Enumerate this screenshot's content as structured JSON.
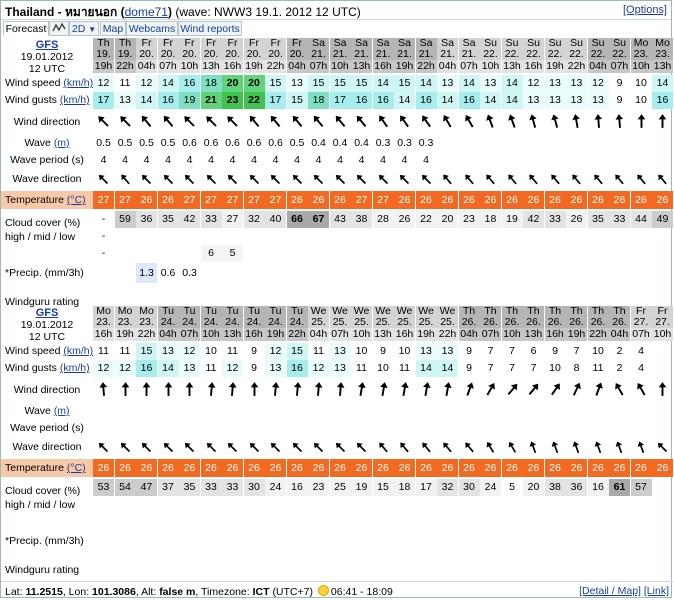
{
  "header": {
    "title_prefix": "Thailand - หมายนอก",
    "spot_link": "dome71",
    "wave_info": "(wave: NWW3 19.1. 2012 12 UTC)",
    "options_link": "[Options]"
  },
  "tabs": {
    "forecast": "Forecast",
    "graph_icon": "graph-icon",
    "twod": "2D",
    "map": "Map",
    "webcams": "Webcams",
    "wind_reports": "Wind reports"
  },
  "labels": {
    "wind_speed": "Wind speed",
    "wind_gusts": "Wind gusts",
    "kmh": "(km/h)",
    "wind_direction": "Wind direction",
    "wave": "Wave",
    "wave_unit": "(m)",
    "wave_period": "Wave period (s)",
    "wave_direction": "Wave direction",
    "temperature": "Temperature",
    "temp_unit": "(°C)",
    "cloud_cover": "Cloud cover (%)",
    "cloud_levels": "high / mid / low",
    "precip": "*Precip. (mm/3h)",
    "rating": "Windguru rating"
  },
  "colors": {
    "header_light": "#d3d3d3",
    "header_dark": "#b5b5b5",
    "temp_bg": "#f26a21",
    "link": "#1a3d9a",
    "cloud_light": "#f2f2f2",
    "cloud_mid": "#cccccc",
    "cloud_dark": "#a9a9a9",
    "precip_bg": "#dfe8fa"
  },
  "blocks": [
    {
      "model": "GFS",
      "date": "19.01.2012",
      "utc": "12 UTC",
      "days": [
        "Th",
        "Th",
        "Fr",
        "Fr",
        "Fr",
        "Fr",
        "Fr",
        "Fr",
        "Fr",
        "Fr",
        "Sa",
        "Sa",
        "Sa",
        "Sa",
        "Sa",
        "Sa",
        "Sa",
        "Sa",
        "Su",
        "Su",
        "Su",
        "Su",
        "Su",
        "Su",
        "Su",
        "Mo",
        "Mo",
        "Mo"
      ],
      "dates": [
        "19.",
        "19.",
        "20.",
        "20.",
        "20.",
        "20.",
        "20.",
        "20.",
        "20.",
        "20.",
        "21.",
        "21.",
        "21.",
        "21.",
        "21.",
        "21.",
        "21.",
        "21.",
        "22.",
        "22.",
        "22.",
        "22.",
        "22.",
        "22.",
        "22.",
        "23.",
        "23.",
        "23."
      ],
      "hours": [
        "19h",
        "22h",
        "04h",
        "07h",
        "10h",
        "13h",
        "16h",
        "19h",
        "22h",
        "04h",
        "07h",
        "10h",
        "13h",
        "16h",
        "19h",
        "22h",
        "04h",
        "07h",
        "10h",
        "13h",
        "16h",
        "19h",
        "22h",
        "04h",
        "07h",
        "10h",
        "13h",
        "13h"
      ],
      "shaded": [
        1,
        1,
        0,
        0,
        0,
        0,
        0,
        0,
        0,
        1,
        1,
        1,
        1,
        1,
        1,
        1,
        0,
        0,
        0,
        0,
        0,
        0,
        0,
        1,
        1,
        1,
        1,
        1
      ],
      "wind_speed": [
        "12",
        "11",
        "12",
        "14",
        "16",
        "18",
        "20",
        "20",
        "15",
        "13",
        "15",
        "15",
        "15",
        "14",
        "15",
        "14",
        "13",
        "14",
        "13",
        "14",
        "12",
        "13",
        "13",
        "12",
        "9",
        "10",
        "14",
        "12"
      ],
      "wind_gusts": [
        "17",
        "13",
        "14",
        "16",
        "19",
        "21",
        "23",
        "22",
        "17",
        "15",
        "18",
        "17",
        "16",
        "16",
        "14",
        "16",
        "14",
        "16",
        "14",
        "14",
        "13",
        "13",
        "13",
        "13",
        "9",
        "10",
        "16",
        "13"
      ],
      "wind_dir": [
        315,
        315,
        320,
        320,
        315,
        315,
        315,
        320,
        320,
        320,
        320,
        320,
        320,
        325,
        325,
        325,
        330,
        330,
        340,
        340,
        345,
        345,
        350,
        355,
        355,
        0,
        0,
        350
      ],
      "wave": [
        "0.5",
        "0.5",
        "0.5",
        "0.5",
        "0.6",
        "0.6",
        "0.6",
        "0.6",
        "0.6",
        "0.5",
        "0.4",
        "0.4",
        "0.4",
        "0.3",
        "0.3",
        "0.3",
        "",
        "",
        "",
        "",
        "",
        "",
        "",
        "",
        "",
        "",
        "",
        ""
      ],
      "wave_period": [
        "4",
        "4",
        "4",
        "4",
        "4",
        "4",
        "4",
        "4",
        "4",
        "4",
        "4",
        "4",
        "4",
        "4",
        "4",
        "4",
        "",
        "",
        "",
        "",
        "",
        "",
        "",
        "",
        "",
        "",
        "",
        ""
      ],
      "wave_dir": [
        315,
        320,
        315,
        315,
        315,
        315,
        315,
        315,
        315,
        315,
        315,
        315,
        315,
        315,
        315,
        315,
        320,
        320,
        320,
        320,
        320,
        320,
        320,
        320,
        320,
        320,
        320,
        315
      ],
      "temperature": [
        "27",
        "27",
        "26",
        "26",
        "27",
        "27",
        "27",
        "27",
        "27",
        "26",
        "26",
        "26",
        "27",
        "27",
        "26",
        "26",
        "26",
        "26",
        "26",
        "26",
        "26",
        "26",
        "26",
        "26",
        "26",
        "26",
        "26",
        "26"
      ],
      "cloud": [
        "-",
        "59",
        "36",
        "35",
        "42",
        "33",
        "27",
        "32",
        "40",
        "66",
        "67",
        "43",
        "38",
        "28",
        "26",
        "22",
        "20",
        "23",
        "18",
        "19",
        "42",
        "33",
        "26",
        "35",
        "33",
        "44",
        "49",
        ""
      ],
      "cloud_mid": [
        "-",
        "",
        "",
        "",
        "",
        "",
        "",
        "",
        "",
        "",
        "",
        "",
        "",
        "",
        "",
        "",
        "",
        "",
        "",
        "",
        "",
        "",
        "",
        "",
        "",
        "",
        "",
        ""
      ],
      "cloud_low": [
        "-",
        "",
        "",
        "",
        "",
        "6",
        "5",
        "",
        "",
        "",
        "",
        "",
        "",
        "",
        "",
        "",
        "",
        "",
        "",
        "",
        "",
        "",
        "",
        "",
        "",
        "",
        "",
        ""
      ],
      "precip": [
        "",
        "",
        "1.3",
        "0.6",
        "0.3",
        "",
        "",
        "",
        "",
        "",
        "",
        "",
        "",
        "",
        "",
        "",
        "",
        "",
        "",
        "",
        "",
        "",
        "",
        "",
        "",
        "",
        "",
        ""
      ]
    },
    {
      "model": "GFS",
      "date": "19.01.2012",
      "utc": "12 UTC",
      "days": [
        "Mo",
        "Mo",
        "Mo",
        "Tu",
        "Tu",
        "Tu",
        "Tu",
        "Tu",
        "Tu",
        "Tu",
        "We",
        "We",
        "We",
        "We",
        "We",
        "We",
        "We",
        "Th",
        "Th",
        "Th",
        "Th",
        "Th",
        "Th",
        "Th",
        "Th",
        "Fr",
        "Fr",
        "Fr"
      ],
      "dates": [
        "23.",
        "23.",
        "23.",
        "24.",
        "24.",
        "24.",
        "24.",
        "24.",
        "24.",
        "24.",
        "25.",
        "25.",
        "25.",
        "25.",
        "25.",
        "25.",
        "25.",
        "26.",
        "26.",
        "26.",
        "26.",
        "26.",
        "26.",
        "26.",
        "26.",
        "27.",
        "27.",
        "27."
      ],
      "hours": [
        "16h",
        "19h",
        "22h",
        "04h",
        "07h",
        "10h",
        "13h",
        "16h",
        "19h",
        "22h",
        "04h",
        "07h",
        "10h",
        "13h",
        "16h",
        "19h",
        "22h",
        "04h",
        "07h",
        "10h",
        "13h",
        "16h",
        "19h",
        "22h",
        "04h",
        "07h",
        "10h",
        "10h"
      ],
      "shaded": [
        0,
        0,
        0,
        1,
        1,
        1,
        1,
        1,
        1,
        1,
        0,
        0,
        0,
        0,
        0,
        0,
        0,
        1,
        1,
        1,
        1,
        1,
        1,
        1,
        1,
        0,
        0,
        0
      ],
      "wind_speed": [
        "11",
        "11",
        "15",
        "13",
        "12",
        "10",
        "11",
        "9",
        "12",
        "15",
        "11",
        "13",
        "10",
        "9",
        "10",
        "13",
        "13",
        "9",
        "7",
        "7",
        "6",
        "9",
        "7",
        "10",
        "2",
        "4",
        "",
        ""
      ],
      "wind_gusts": [
        "12",
        "12",
        "16",
        "14",
        "13",
        "11",
        "12",
        "9",
        "13",
        "16",
        "12",
        "13",
        "11",
        "10",
        "11",
        "14",
        "14",
        "9",
        "7",
        "7",
        "7",
        "10",
        "8",
        "11",
        "2",
        "4",
        "",
        ""
      ],
      "wind_dir": [
        355,
        0,
        0,
        0,
        0,
        5,
        5,
        0,
        5,
        5,
        5,
        5,
        10,
        10,
        10,
        10,
        10,
        20,
        30,
        40,
        40,
        35,
        25,
        20,
        330,
        330,
        0,
        0
      ],
      "wave": [
        "",
        "",
        "",
        "",
        "",
        "",
        "",
        "",
        "",
        "",
        "",
        "",
        "",
        "",
        "",
        "",
        "",
        "",
        "",
        "",
        "",
        "",
        "",
        "",
        "",
        "",
        "",
        ""
      ],
      "wave_period": [
        "",
        "",
        "",
        "",
        "",
        "",
        "",
        "",
        "",
        "",
        "",
        "",
        "",
        "",
        "",
        "",
        "",
        "",
        "",
        "",
        "",
        "",
        "",
        "",
        "",
        "",
        "",
        ""
      ],
      "wave_dir": [
        315,
        315,
        315,
        315,
        315,
        315,
        315,
        315,
        315,
        315,
        315,
        315,
        315,
        320,
        320,
        320,
        320,
        320,
        330,
        330,
        340,
        340,
        340,
        340,
        340,
        340,
        315,
        315
      ],
      "temperature": [
        "26",
        "26",
        "26",
        "26",
        "26",
        "26",
        "26",
        "26",
        "26",
        "26",
        "26",
        "26",
        "26",
        "26",
        "26",
        "26",
        "26",
        "26",
        "26",
        "26",
        "26",
        "26",
        "26",
        "26",
        "26",
        "26",
        "26",
        ""
      ],
      "cloud": [
        "53",
        "54",
        "47",
        "37",
        "35",
        "33",
        "33",
        "30",
        "24",
        "16",
        "23",
        "25",
        "19",
        "15",
        "18",
        "17",
        "32",
        "30",
        "24",
        "5",
        "20",
        "38",
        "36",
        "16",
        "61",
        "57",
        "",
        ""
      ],
      "cloud_mid": [
        "",
        "",
        "",
        "",
        "",
        "",
        "",
        "",
        "",
        "",
        "",
        "",
        "",
        "",
        "",
        "",
        "",
        "",
        "",
        "",
        "",
        "",
        "",
        "",
        "",
        "",
        "",
        ""
      ],
      "cloud_low": [
        "",
        "",
        "",
        "",
        "",
        "",
        "",
        "",
        "",
        "",
        "",
        "",
        "",
        "",
        "",
        "",
        "",
        "",
        "",
        "",
        "",
        "",
        "",
        "",
        "",
        "",
        "",
        ""
      ],
      "precip": [
        "",
        "",
        "",
        "",
        "",
        "",
        "",
        "",
        "",
        "",
        "",
        "",
        "",
        "",
        "",
        "",
        "",
        "",
        "",
        "",
        "",
        "",
        "",
        "",
        "",
        "",
        "",
        ""
      ]
    }
  ],
  "footer": {
    "lat_label": "Lat:",
    "lat": "11.2515",
    "lon_label": "Lon:",
    "lon": "101.3086",
    "alt_label": "Alt:",
    "alt": "false m",
    "tz_label": "Timezone:",
    "tz": "ICT",
    "tz_offset": "(UTC+7)",
    "sun": "06:41 - 18:09",
    "detail_map": "[Detail / Map]",
    "link": "[Link]"
  }
}
